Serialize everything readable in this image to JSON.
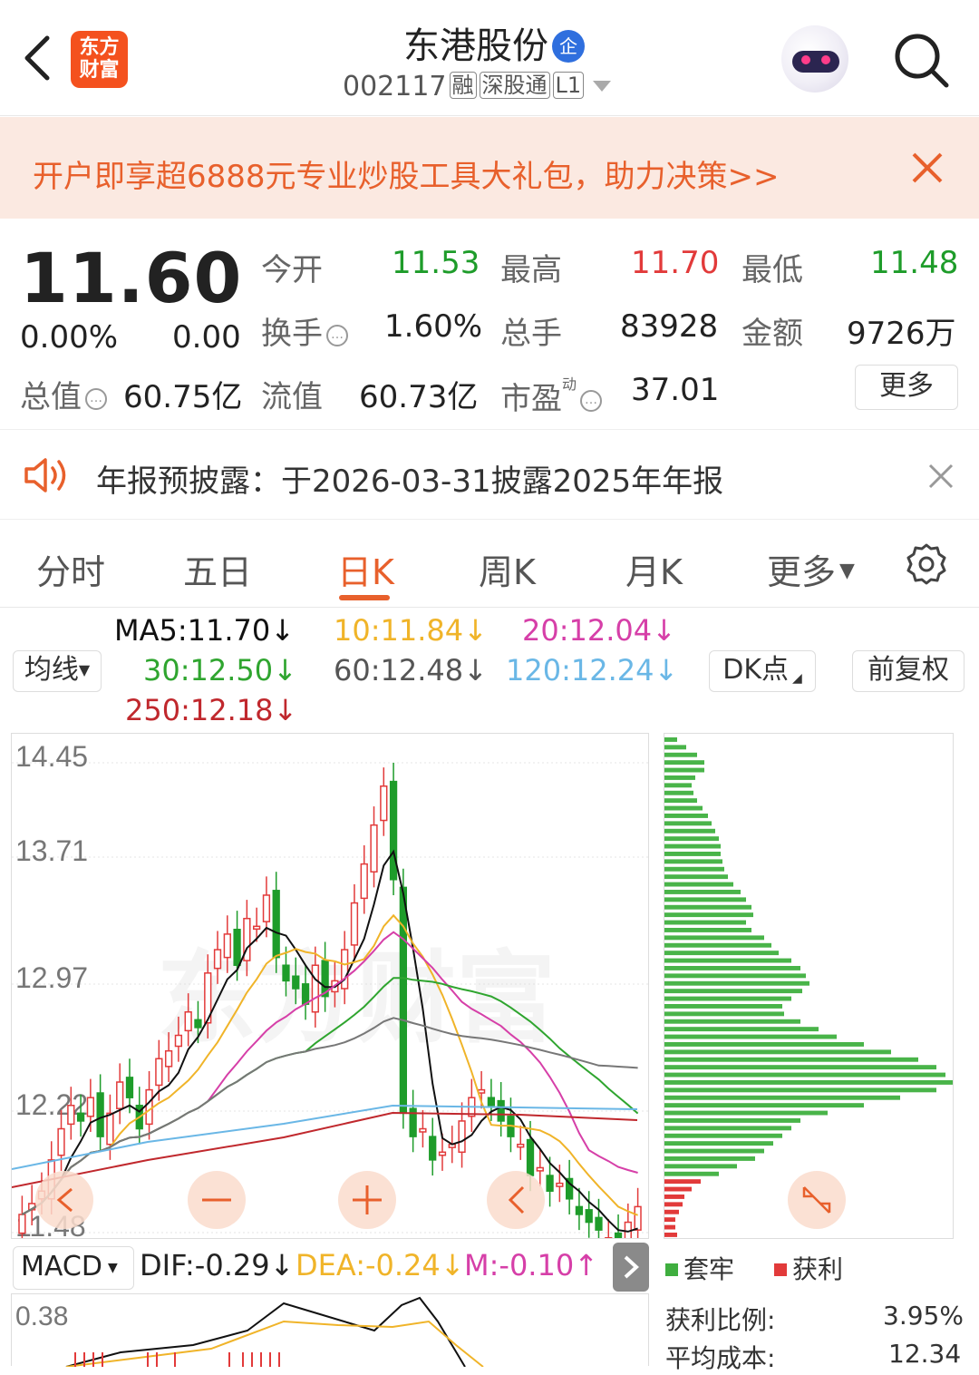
{
  "header": {
    "app_logo_text": "东方\n财富",
    "stock_name": "东港股份",
    "enterprise_badge": "企",
    "stock_code": "002117",
    "tags": [
      "融",
      "深股通",
      "L1"
    ]
  },
  "ad_banner": {
    "text": "开户即享超6888元专业炒股工具大礼包，助力决策>>"
  },
  "quote": {
    "price": "11.60",
    "change_pct": "0.00%",
    "change": "0.00",
    "open_label": "今开",
    "open": "11.53",
    "high_label": "最高",
    "high": "11.70",
    "low_label": "最低",
    "low": "11.48",
    "turnover_label": "换手",
    "turnover": "1.60%",
    "volume_label": "总手",
    "volume": "83928",
    "amount_label": "金额",
    "amount": "9726万",
    "mcap_label": "总值",
    "mcap": "60.75亿",
    "float_label": "流值",
    "float": "60.73亿",
    "pe_label": "市盈",
    "pe_sup": "动",
    "pe": "37.01",
    "more": "更多"
  },
  "notice": {
    "text": "年报预披露：于2026-03-31披露2025年年报"
  },
  "tabs": [
    "分时",
    "五日",
    "日K",
    "周K",
    "月K",
    "更多"
  ],
  "active_tab": "日K",
  "ma_panel": {
    "select_label": "均线",
    "ma5": "MA5:11.70↓",
    "ma10": "10:11.84↓",
    "ma20": "20:12.04↓",
    "ma30": "30:12.50↓",
    "ma60": "60:12.48↓",
    "ma120": "120:12.24↓",
    "ma250": "250:12.18↓",
    "dk_button": "DK点",
    "adjust_button": "前复权"
  },
  "kline": {
    "y_labels": [
      "14.45",
      "13.71",
      "12.97",
      "12.22",
      "11.48"
    ],
    "watermark": "东方财富",
    "colors": {
      "up": "#e23a3a",
      "down": "#1e9c2a",
      "ma5": "#111111",
      "ma10": "#f0b429",
      "ma20": "#d63fa8",
      "ma30": "#2fa52f",
      "ma60": "#777777",
      "ma120": "#6ab7e6",
      "ma250": "#c0282d"
    }
  },
  "chip_dist": {
    "legend_trapped": "套牢",
    "legend_profit": "获利",
    "profit_ratio_label": "获利比例:",
    "profit_ratio": "3.95%",
    "avg_cost_label": "平均成本:",
    "avg_cost": "12.34"
  },
  "macd": {
    "select_label": "MACD",
    "dif": "DIF:-0.29↓",
    "dea": "DEA:-0.24↓",
    "m": "M:-0.10↑",
    "y_label": "0.38"
  }
}
